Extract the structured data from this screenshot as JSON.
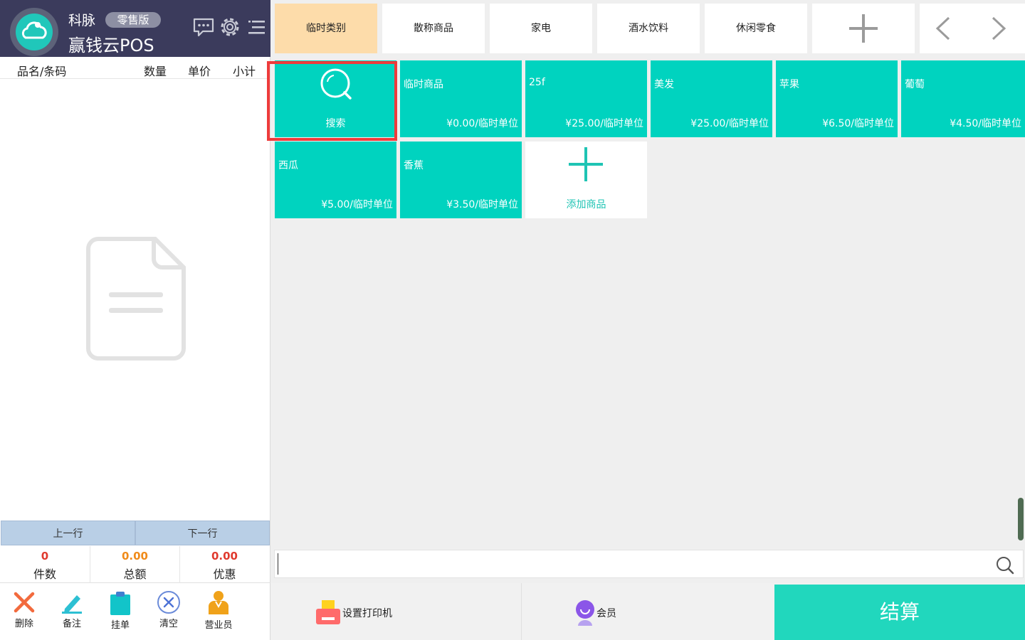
{
  "brand": {
    "company": "科脉",
    "edition": "零售版",
    "product": "赢钱云POS"
  },
  "order_table": {
    "columns": [
      "品名/条码",
      "数量",
      "单价",
      "小计"
    ]
  },
  "nav": {
    "prev_row": "上一行",
    "next_row": "下一行"
  },
  "summary": {
    "count": {
      "value": "0",
      "label": "件数",
      "color": "#e03a2e"
    },
    "total": {
      "value": "0.00",
      "label": "总额",
      "color": "#f08b1a"
    },
    "discount": {
      "value": "0.00",
      "label": "优惠",
      "color": "#e03a2e"
    }
  },
  "actions": [
    {
      "label": "删除",
      "icon": "close-icon"
    },
    {
      "label": "备注",
      "icon": "pen-icon"
    },
    {
      "label": "挂单",
      "icon": "clipboard-icon"
    },
    {
      "label": "清空",
      "icon": "clear-circle-icon"
    },
    {
      "label": "营业员",
      "icon": "cashier-icon"
    }
  ],
  "categories": [
    {
      "label": "临时类别",
      "active": true
    },
    {
      "label": "散称商品"
    },
    {
      "label": "家电"
    },
    {
      "label": "酒水饮料"
    },
    {
      "label": "休闲零食"
    }
  ],
  "products": [
    {
      "label": "搜索",
      "type": "search"
    },
    {
      "name": "临时商品",
      "price": "¥0.00/临时单位"
    },
    {
      "name": "25f",
      "price": "¥25.00/临时单位"
    },
    {
      "name": "美发",
      "price": "¥25.00/临时单位"
    },
    {
      "name": "苹果",
      "price": "¥6.50/临时单位"
    },
    {
      "name": "葡萄",
      "price": "¥4.50/临时单位"
    },
    {
      "name": "西瓜",
      "price": "¥5.00/临时单位"
    },
    {
      "name": "香蕉",
      "price": "¥3.50/临时单位"
    },
    {
      "label": "添加商品",
      "type": "add"
    }
  ],
  "search": {
    "value": "",
    "placeholder": ""
  },
  "bottom": {
    "printer": "设置打印机",
    "member": "会员",
    "checkout": "结算"
  },
  "colors": {
    "tile": "#00d3bf",
    "brand_bar": "#3b3b5c",
    "active_category": "#fddcaa",
    "checkout": "#21d7bd",
    "highlight": "#ee3b3b"
  }
}
